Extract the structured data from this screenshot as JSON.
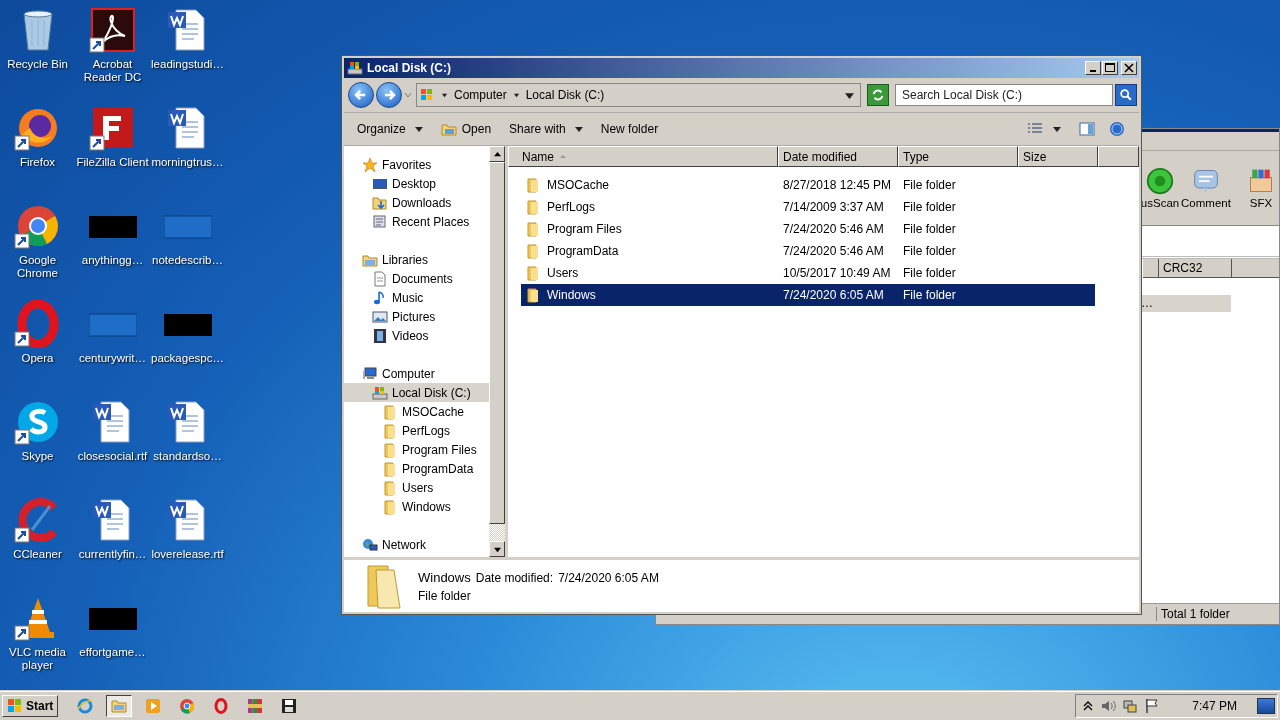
{
  "desktop_icons": [
    {
      "label": "Recycle Bin",
      "kind": "recycle",
      "shortcut": false
    },
    {
      "label": "Acrobat Reader DC",
      "kind": "acrobat",
      "shortcut": true
    },
    {
      "label": "leadingstudi…",
      "kind": "word",
      "shortcut": false
    },
    {
      "label": "Firefox",
      "kind": "firefox",
      "shortcut": true
    },
    {
      "label": "FileZilla Client",
      "kind": "filezilla",
      "shortcut": true
    },
    {
      "label": "morningtrus…",
      "kind": "word",
      "shortcut": false
    },
    {
      "label": "Google Chrome",
      "kind": "chrome",
      "shortcut": true
    },
    {
      "label": "anythingg…",
      "kind": "thumb-dark",
      "shortcut": false
    },
    {
      "label": "notedescrib…",
      "kind": "thumb-blue",
      "shortcut": false
    },
    {
      "label": "Opera",
      "kind": "opera",
      "shortcut": true
    },
    {
      "label": "centurywrit…",
      "kind": "thumb-blue",
      "shortcut": false
    },
    {
      "label": "packagespc…",
      "kind": "thumb-dark",
      "shortcut": false
    },
    {
      "label": "Skype",
      "kind": "skype",
      "shortcut": true
    },
    {
      "label": "closesocial.rtf",
      "kind": "word",
      "shortcut": false
    },
    {
      "label": "standardso…",
      "kind": "word",
      "shortcut": false
    },
    {
      "label": "CCleaner",
      "kind": "ccleaner",
      "shortcut": true
    },
    {
      "label": "currentlyfin…",
      "kind": "word",
      "shortcut": false
    },
    {
      "label": "loverelease.rtf",
      "kind": "word",
      "shortcut": false
    },
    {
      "label": "VLC media player",
      "kind": "vlc",
      "shortcut": true
    },
    {
      "label": "effortgame…",
      "kind": "thumb-dark",
      "shortcut": false
    }
  ],
  "background_window": {
    "toolbar": [
      "usScan",
      "Comment",
      "SFX"
    ],
    "column": "CRC32",
    "row": "…",
    "status_right": "Total 1 folder"
  },
  "window": {
    "title": "Local Disk (C:)",
    "breadcrumbs": [
      "Computer",
      "Local Disk (C:)"
    ],
    "search": {
      "placeholder": "Search Local Disk (C:)"
    },
    "toolbar": [
      {
        "label": "Organize",
        "kind": "menu"
      },
      {
        "label": "Open",
        "kind": "open"
      },
      {
        "label": "Share with",
        "kind": "menu"
      },
      {
        "label": "New folder",
        "kind": "plain"
      }
    ],
    "nav": [
      {
        "label": "Favorites",
        "kind": "star",
        "selected": false,
        "children": [
          {
            "label": "Desktop",
            "kind": "desktop",
            "selected": false
          },
          {
            "label": "Downloads",
            "kind": "downloads",
            "selected": false
          },
          {
            "label": "Recent Places",
            "kind": "recent",
            "selected": false
          }
        ]
      },
      {
        "label": "Libraries",
        "kind": "library",
        "selected": false,
        "children": [
          {
            "label": "Documents",
            "kind": "document",
            "selected": false
          },
          {
            "label": "Music",
            "kind": "music",
            "selected": false
          },
          {
            "label": "Pictures",
            "kind": "pictures",
            "selected": false
          },
          {
            "label": "Videos",
            "kind": "videos",
            "selected": false
          }
        ]
      },
      {
        "label": "Computer",
        "kind": "computer",
        "selected": false,
        "children": [
          {
            "label": "Local Disk (C:)",
            "kind": "drive",
            "selected": true,
            "children": [
              {
                "label": "MSOCache",
                "kind": "folder",
                "selected": false
              },
              {
                "label": "PerfLogs",
                "kind": "folder",
                "selected": false
              },
              {
                "label": "Program Files",
                "kind": "folder",
                "selected": false
              },
              {
                "label": "ProgramData",
                "kind": "folder",
                "selected": false
              },
              {
                "label": "Users",
                "kind": "folder",
                "selected": false
              },
              {
                "label": "Windows",
                "kind": "folder",
                "selected": false
              }
            ]
          }
        ]
      },
      {
        "label": "Network",
        "kind": "network",
        "selected": false
      }
    ],
    "columns": [
      {
        "label": "Name",
        "sorted": true
      },
      {
        "label": "Date modified",
        "sorted": false
      },
      {
        "label": "Type",
        "sorted": false
      },
      {
        "label": "Size",
        "sorted": false
      }
    ],
    "rows": [
      {
        "name": "MSOCache",
        "date": "8/27/2018 12:45 PM",
        "type": "File folder",
        "selected": false
      },
      {
        "name": "PerfLogs",
        "date": "7/14/2009 3:37 AM",
        "type": "File folder",
        "selected": false
      },
      {
        "name": "Program Files",
        "date": "7/24/2020 5:46 AM",
        "type": "File folder",
        "selected": false
      },
      {
        "name": "ProgramData",
        "date": "7/24/2020 5:46 AM",
        "type": "File folder",
        "selected": false
      },
      {
        "name": "Users",
        "date": "10/5/2017 10:49 AM",
        "type": "File folder",
        "selected": false
      },
      {
        "name": "Windows",
        "date": "7/24/2020 6:05 AM",
        "type": "File folder",
        "selected": true
      }
    ],
    "details": {
      "name": "Windows",
      "date_label": "Date modified:",
      "date": "7/24/2020 6:05 AM",
      "type": "File folder"
    }
  },
  "taskbar": {
    "start": "Start",
    "apps": [
      {
        "kind": "ie",
        "active": false
      },
      {
        "kind": "explorer",
        "active": true
      },
      {
        "kind": "media",
        "active": false
      },
      {
        "kind": "chrome",
        "active": false
      },
      {
        "kind": "opera",
        "active": false
      },
      {
        "kind": "winrar",
        "active": false
      },
      {
        "kind": "floppy",
        "active": false
      }
    ],
    "time": "7:47 PM"
  }
}
